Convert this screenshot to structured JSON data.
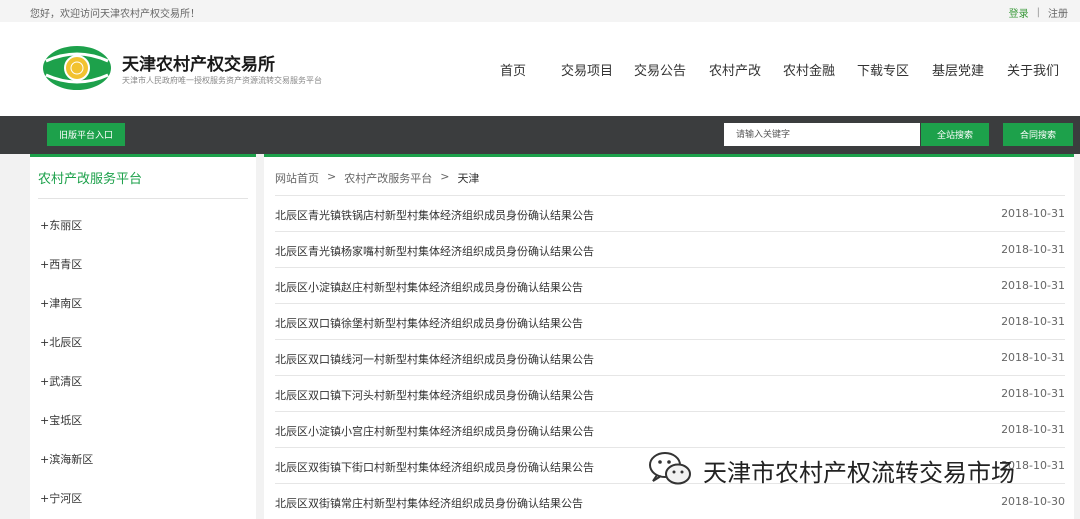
{
  "topbar": {
    "welcome": "您好，欢迎访问天津农村产权交易所！",
    "login": "登录",
    "separator": "|",
    "register": "注册"
  },
  "header": {
    "site_name": "天津农村产权交易所",
    "site_sub": "天津市人民政府唯一授权服务资产资源流转交易服务平台",
    "nav": [
      "首页",
      "交易项目",
      "交易公告",
      "农村产改",
      "农村金融",
      "下载专区",
      "基层党建",
      "关于我们"
    ]
  },
  "toolbar": {
    "portal_label": "旧版平台入口",
    "search_placeholder": "请输入关键字",
    "site_search_label": "全站搜索",
    "contract_search_label": "合同搜索"
  },
  "sidebar": {
    "title": "农村产改服务平台",
    "items": [
      "+东丽区",
      "+西青区",
      "+津南区",
      "+北辰区",
      "+武清区",
      "+宝坻区",
      "+滨海新区",
      "+宁河区"
    ]
  },
  "breadcrumb": {
    "home": "网站首页",
    "arrow": ">",
    "section": "农村产改服务平台",
    "current": "天津"
  },
  "notices": [
    {
      "title": "北辰区青光镇铁锅店村新型村集体经济组织成员身份确认结果公告",
      "date": "2018-10-31"
    },
    {
      "title": "北辰区青光镇杨家嘴村新型村集体经济组织成员身份确认结果公告",
      "date": "2018-10-31"
    },
    {
      "title": "北辰区小淀镇赵庄村新型村集体经济组织成员身份确认结果公告",
      "date": "2018-10-31"
    },
    {
      "title": "北辰区双口镇徐堡村新型村集体经济组织成员身份确认结果公告",
      "date": "2018-10-31"
    },
    {
      "title": "北辰区双口镇线河一村新型村集体经济组织成员身份确认结果公告",
      "date": "2018-10-31"
    },
    {
      "title": "北辰区双口镇下河头村新型村集体经济组织成员身份确认结果公告",
      "date": "2018-10-31"
    },
    {
      "title": "北辰区小淀镇小宫庄村新型村集体经济组织成员身份确认结果公告",
      "date": "2018-10-31"
    },
    {
      "title": "北辰区双街镇下街口村新型村集体经济组织成员身份确认结果公告",
      "date": "2018-10-31"
    },
    {
      "title": "北辰区双街镇常庄村新型村集体经济组织成员身份确认结果公告",
      "date": "2018-10-30"
    }
  ],
  "watermark": {
    "text": "天津市农村产权流转交易市场",
    "icon": "wechat-icon"
  },
  "colors": {
    "accent": "#1da14b",
    "dark_bar": "#3b3d3e"
  }
}
